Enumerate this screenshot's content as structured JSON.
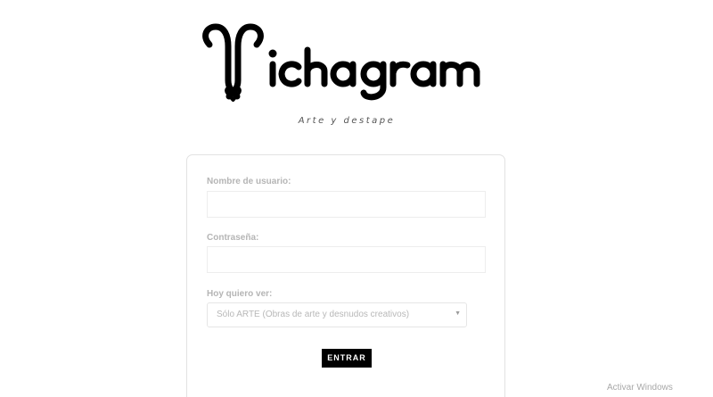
{
  "brand": {
    "logo_text": "Vichagram",
    "tagline": "Arte y destape"
  },
  "login_form": {
    "username_label": "Nombre de usuario:",
    "username_value": "",
    "password_label": "Contraseña:",
    "password_value": "",
    "view_label": "Hoy quiero ver:",
    "view_selected": "Sólo ARTE (Obras de arte y desnudos creativos)",
    "submit_label": "ENTRAR"
  },
  "icons": {
    "select_arrow": "chevron-down-icon"
  },
  "os_overlay": {
    "watermark": "Activar Windows"
  },
  "colors": {
    "brand": "#000000",
    "button_bg": "#000000",
    "button_text": "#ffffff",
    "label": "#b5b5b5"
  }
}
